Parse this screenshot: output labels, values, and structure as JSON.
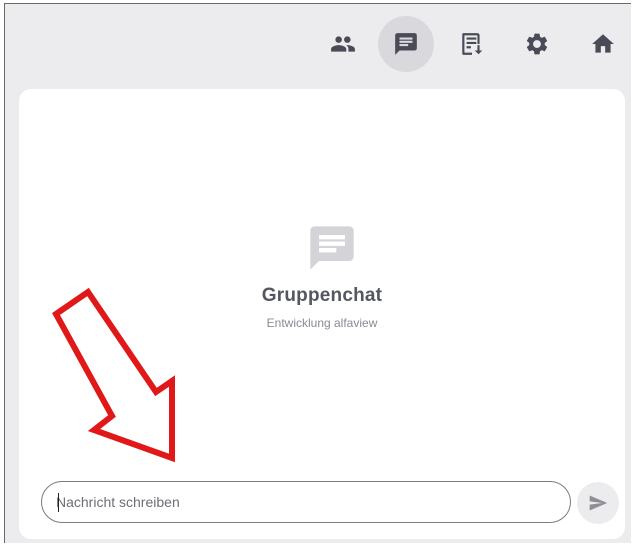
{
  "toolbar": {
    "buttons": [
      {
        "icon": "people-icon",
        "active": false
      },
      {
        "icon": "chat-icon",
        "active": true
      },
      {
        "icon": "file-download-icon",
        "active": false
      },
      {
        "icon": "gear-icon",
        "active": false
      },
      {
        "icon": "home-icon",
        "active": false
      }
    ],
    "icon_color": "#4a4b57",
    "active_bg": "#d9d9dd"
  },
  "chat": {
    "empty_icon": "chat-bubble-icon",
    "title": "Gruppenchat",
    "subtitle": "Entwicklung alfaview"
  },
  "composer": {
    "placeholder": "Nachricht schreiben",
    "value": "",
    "send_icon": "send-icon"
  },
  "annotation": {
    "arrow_color": "#e01818",
    "arrow_icon": "red-arrow-annotation"
  }
}
